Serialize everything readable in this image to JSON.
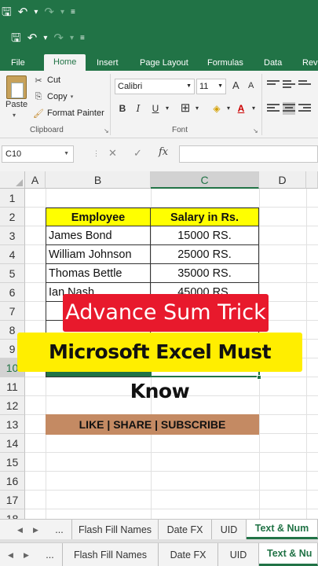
{
  "colors": {
    "excel_green": "#217346",
    "header_yellow": "#ffff00",
    "banner_brown": "#c48a63",
    "overlay_red": "#e8192c",
    "overlay_yellow": "#ffee00"
  },
  "ribbon": {
    "tabs": [
      "File",
      "Home",
      "Insert",
      "Page Layout",
      "Formulas",
      "Data",
      "Rev"
    ],
    "active_tab": "Home",
    "clipboard": {
      "paste": "Paste",
      "cut": "Cut",
      "copy": "Copy",
      "format_painter": "Format Painter",
      "group_label": "Clipboard"
    },
    "font": {
      "name": "Calibri",
      "size": "11",
      "bold": "B",
      "italic": "I",
      "underline": "U",
      "grow": "A",
      "shrink": "A",
      "group_label": "Font"
    }
  },
  "formula_bar": {
    "name_box": "C10",
    "cancel": "✕",
    "enter": "✓",
    "fx": "fx",
    "value": ""
  },
  "grid": {
    "columns": [
      "A",
      "B",
      "C",
      "D"
    ],
    "selected_column": "C",
    "rows": [
      "1",
      "2",
      "3",
      "4",
      "5",
      "6",
      "7",
      "8",
      "9",
      "10",
      "11",
      "12",
      "13",
      "14",
      "15",
      "16",
      "17",
      "18"
    ],
    "selected_row": "10",
    "table": {
      "headers": [
        "Employee",
        "Salary in Rs."
      ],
      "rows": [
        {
          "name": "James Bond",
          "salary": "15000 RS."
        },
        {
          "name": "William Johnson",
          "salary": "25000 RS."
        },
        {
          "name": "Thomas Bettle",
          "salary": "35000 RS."
        },
        {
          "name": "Ian Nash",
          "salary": "45000 RS."
        }
      ]
    },
    "banner": "LIKE | SHARE | SUBSCRIBE"
  },
  "overlay": {
    "line1": "Advance Sum Trick",
    "line2": "Microsoft Excel Must Know"
  },
  "sheet_tabs": [
    "...",
    "Flash Fill Names",
    "Date FX",
    "UID",
    "Text & Num"
  ],
  "sheet_tabs_second": [
    "...",
    "Flash Fill Names",
    "Date FX",
    "UID",
    "Text & Nu"
  ]
}
